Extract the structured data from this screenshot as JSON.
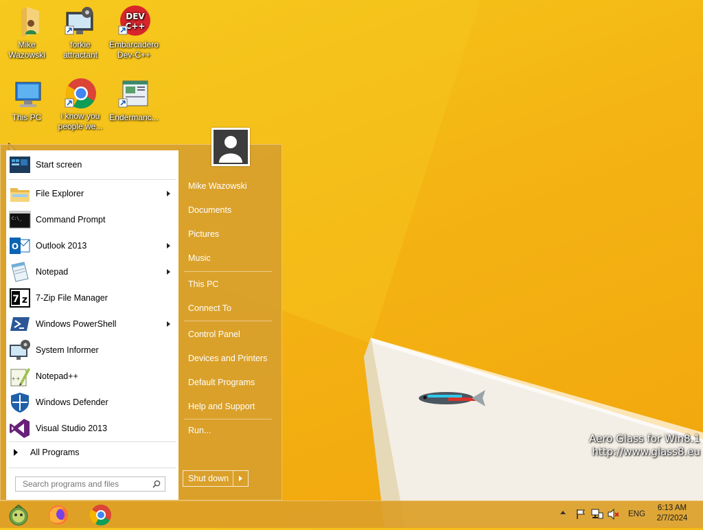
{
  "desktop": {
    "icons": [
      {
        "label": "Mike Wazowski"
      },
      {
        "label": "forkie attractant"
      },
      {
        "label": "Embarcadero Dev-C++"
      },
      {
        "label": "This PC"
      },
      {
        "label": "i know you people we..."
      },
      {
        "label": "Endermanc..."
      }
    ],
    "devcpp_badge": "DEV\nC++"
  },
  "start_menu": {
    "left_items": [
      {
        "label": "Start screen"
      },
      {
        "label": "File Explorer"
      },
      {
        "label": "Command Prompt"
      },
      {
        "label": "Outlook 2013"
      },
      {
        "label": "Notepad"
      },
      {
        "label": "7-Zip File Manager"
      },
      {
        "label": "Windows PowerShell"
      },
      {
        "label": "System Informer"
      },
      {
        "label": "Notepad++"
      },
      {
        "label": "Windows Defender"
      },
      {
        "label": "Visual Studio 2013"
      }
    ],
    "all_programs": "All Programs",
    "search_placeholder": "Search programs and files",
    "right_items": [
      {
        "label": "Mike Wazowski"
      },
      {
        "label": "Documents"
      },
      {
        "label": "Pictures"
      },
      {
        "label": "Music"
      },
      {
        "label": "This PC"
      },
      {
        "label": "Connect To"
      },
      {
        "label": "Control Panel"
      },
      {
        "label": "Devices and Printers"
      },
      {
        "label": "Default Programs"
      },
      {
        "label": "Help and Support"
      },
      {
        "label": "Run..."
      }
    ],
    "shutdown_label": "Shut down"
  },
  "taskbar": {
    "language": "ENG",
    "time": "6:13 AM",
    "date": "2/7/2024"
  },
  "watermark": {
    "line1": "Aero Glass for Win8.1",
    "line2": "http://www.glass8.eu"
  },
  "colors": {
    "wallpaper": "#f4b413",
    "menu_glass": "#d69e2e",
    "outlook_blue": "#0a64b4",
    "vs_purple": "#68217a",
    "defender_blue": "#1e5fa8"
  }
}
